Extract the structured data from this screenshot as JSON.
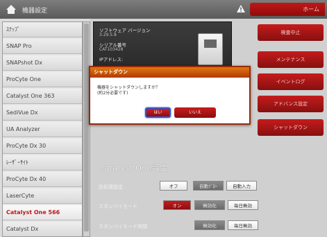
{
  "topbar": {
    "breadcrumb": "機器設定",
    "right_label": "ホーム"
  },
  "sidebar": {
    "items": [
      {
        "label": "ｽﾅｯﾌﾟ"
      },
      {
        "label": "SNAP Pro"
      },
      {
        "label": "SNAPshot Dx"
      },
      {
        "label": "ProCyte One"
      },
      {
        "label": "Catalyst One 363"
      },
      {
        "label": "SediVue Dx"
      },
      {
        "label": "UA Analyzer"
      },
      {
        "label": "ProCyte Dx 30"
      },
      {
        "label": "ﾚｰｻﾞｰｻｲﾄ"
      },
      {
        "label": "ProCyte Dx 40"
      },
      {
        "label": "LaserCyte"
      },
      {
        "label": "Catalyst One 566"
      },
      {
        "label": "Catalyst Dx"
      }
    ],
    "active_index": 11
  },
  "info": {
    "software_label": "ソフトウェア バージョン",
    "software_value": "3.29.5.8",
    "serial_label": "シリアル番号",
    "serial_value": "CAT103428",
    "ip_label": "IPアドレス:"
  },
  "actions": {
    "standby": "検査中止",
    "maintenance": "メンテナンス",
    "log": "イベントログ",
    "advanced": "アドバンス設定",
    "shutdown": "シャットダウン"
  },
  "settings": {
    "title": "Catalyst One設定",
    "rows": [
      {
        "label": "前処理設定",
        "options": [
          "オフ",
          "自動ﾌﾞﾛｰ",
          "自動入力"
        ],
        "selected": 1
      },
      {
        "label": "スタンバイモード",
        "options": [
          "オン",
          "無効化",
          "毎日無効"
        ],
        "selected": 0
      },
      {
        "label": "スタンバイモード時間",
        "options": [
          "無効化",
          "毎日無効"
        ],
        "selected": 0
      }
    ]
  },
  "dialog": {
    "title": "シャットダウン",
    "message_line1": "機器をシャットダウンしますか？",
    "message_line2": "(約2分必要です)",
    "yes_label": "はい",
    "no_label": "いいえ"
  },
  "colors": {
    "accent_red": "#c11717",
    "dialog_title": "#d06010",
    "focus_ring": "#2b57d8"
  }
}
